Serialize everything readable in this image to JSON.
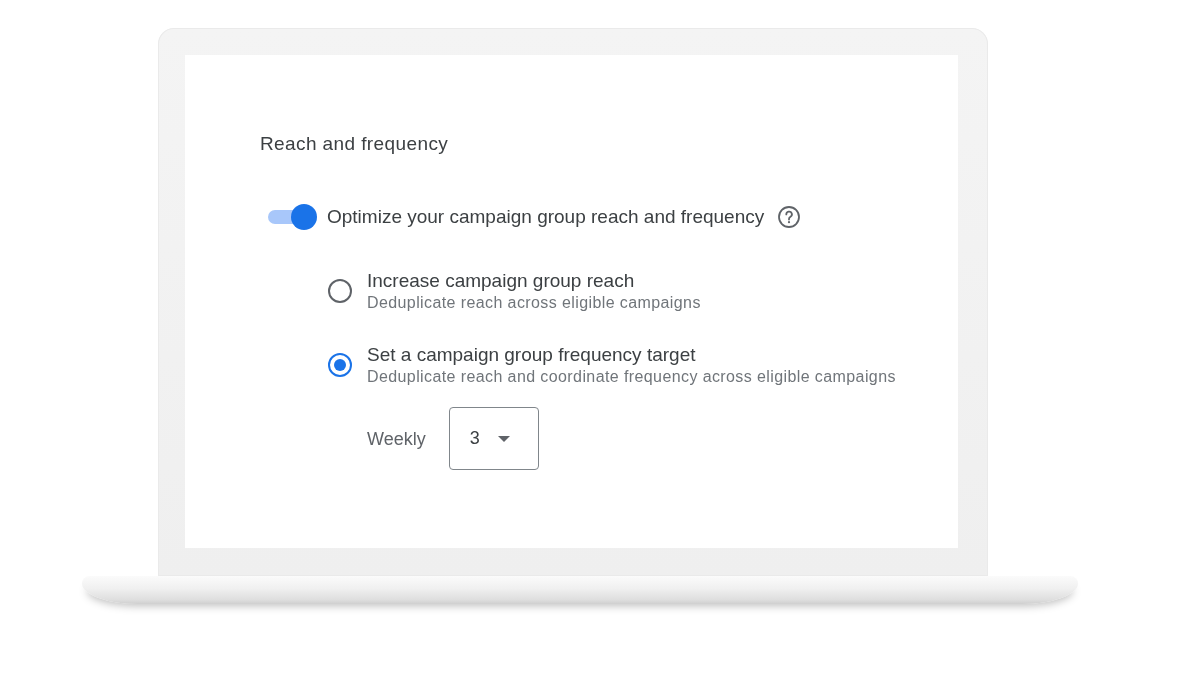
{
  "title": "Reach and frequency",
  "toggle": {
    "label": "Optimize your campaign group reach and frequency",
    "on": true
  },
  "options": [
    {
      "title": "Increase campaign group reach",
      "description": "Deduplicate reach across eligible campaigns",
      "selected": false
    },
    {
      "title": "Set a campaign group frequency target",
      "description": "Deduplicate reach and coordinate frequency across eligible campaigns",
      "selected": true
    }
  ],
  "frequency": {
    "label": "Weekly",
    "value": "3"
  }
}
